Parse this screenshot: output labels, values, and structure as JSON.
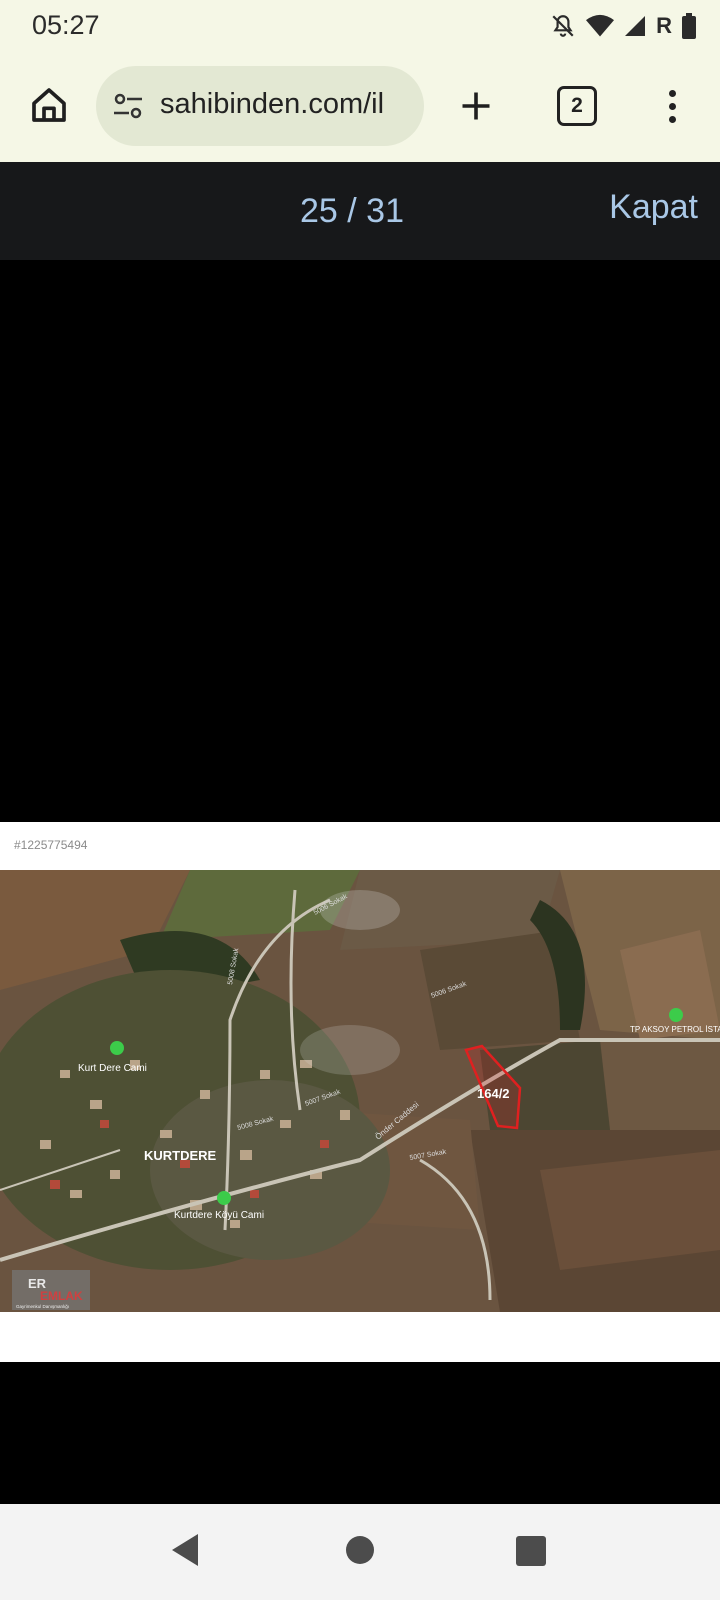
{
  "status": {
    "time": "05:27",
    "carrier_flag": "R",
    "icons": [
      "bell-off-icon",
      "wifi-icon",
      "signal-icon",
      "battery-icon"
    ]
  },
  "browser": {
    "url": "sahibinden.com/il",
    "tab_count": "2"
  },
  "gallery": {
    "counter": "25 / 31",
    "close_label": "Kapat"
  },
  "photo": {
    "listing_id": "#1225775494",
    "map_labels": {
      "town": "KURTDERE",
      "mosque_1": "Kurt Dere Cami",
      "mosque_2": "Kurtdere Köyü Cami",
      "station": "TP AKSOY PETROL İSTAS",
      "parcel": "164/2",
      "street_1": "5006 Sokak",
      "street_2": "5007 Sokak",
      "street_3": "5008 Sokak",
      "street_4": "Önder Caddesi",
      "street_5": "5007 Sokak",
      "street_6": "5006 Sokak",
      "street_7": "5008 Sokak",
      "watermark_1": "ER",
      "watermark_2": "EMLAK",
      "watermark_3": "Gayrimenkul Danışmanlığı"
    }
  }
}
